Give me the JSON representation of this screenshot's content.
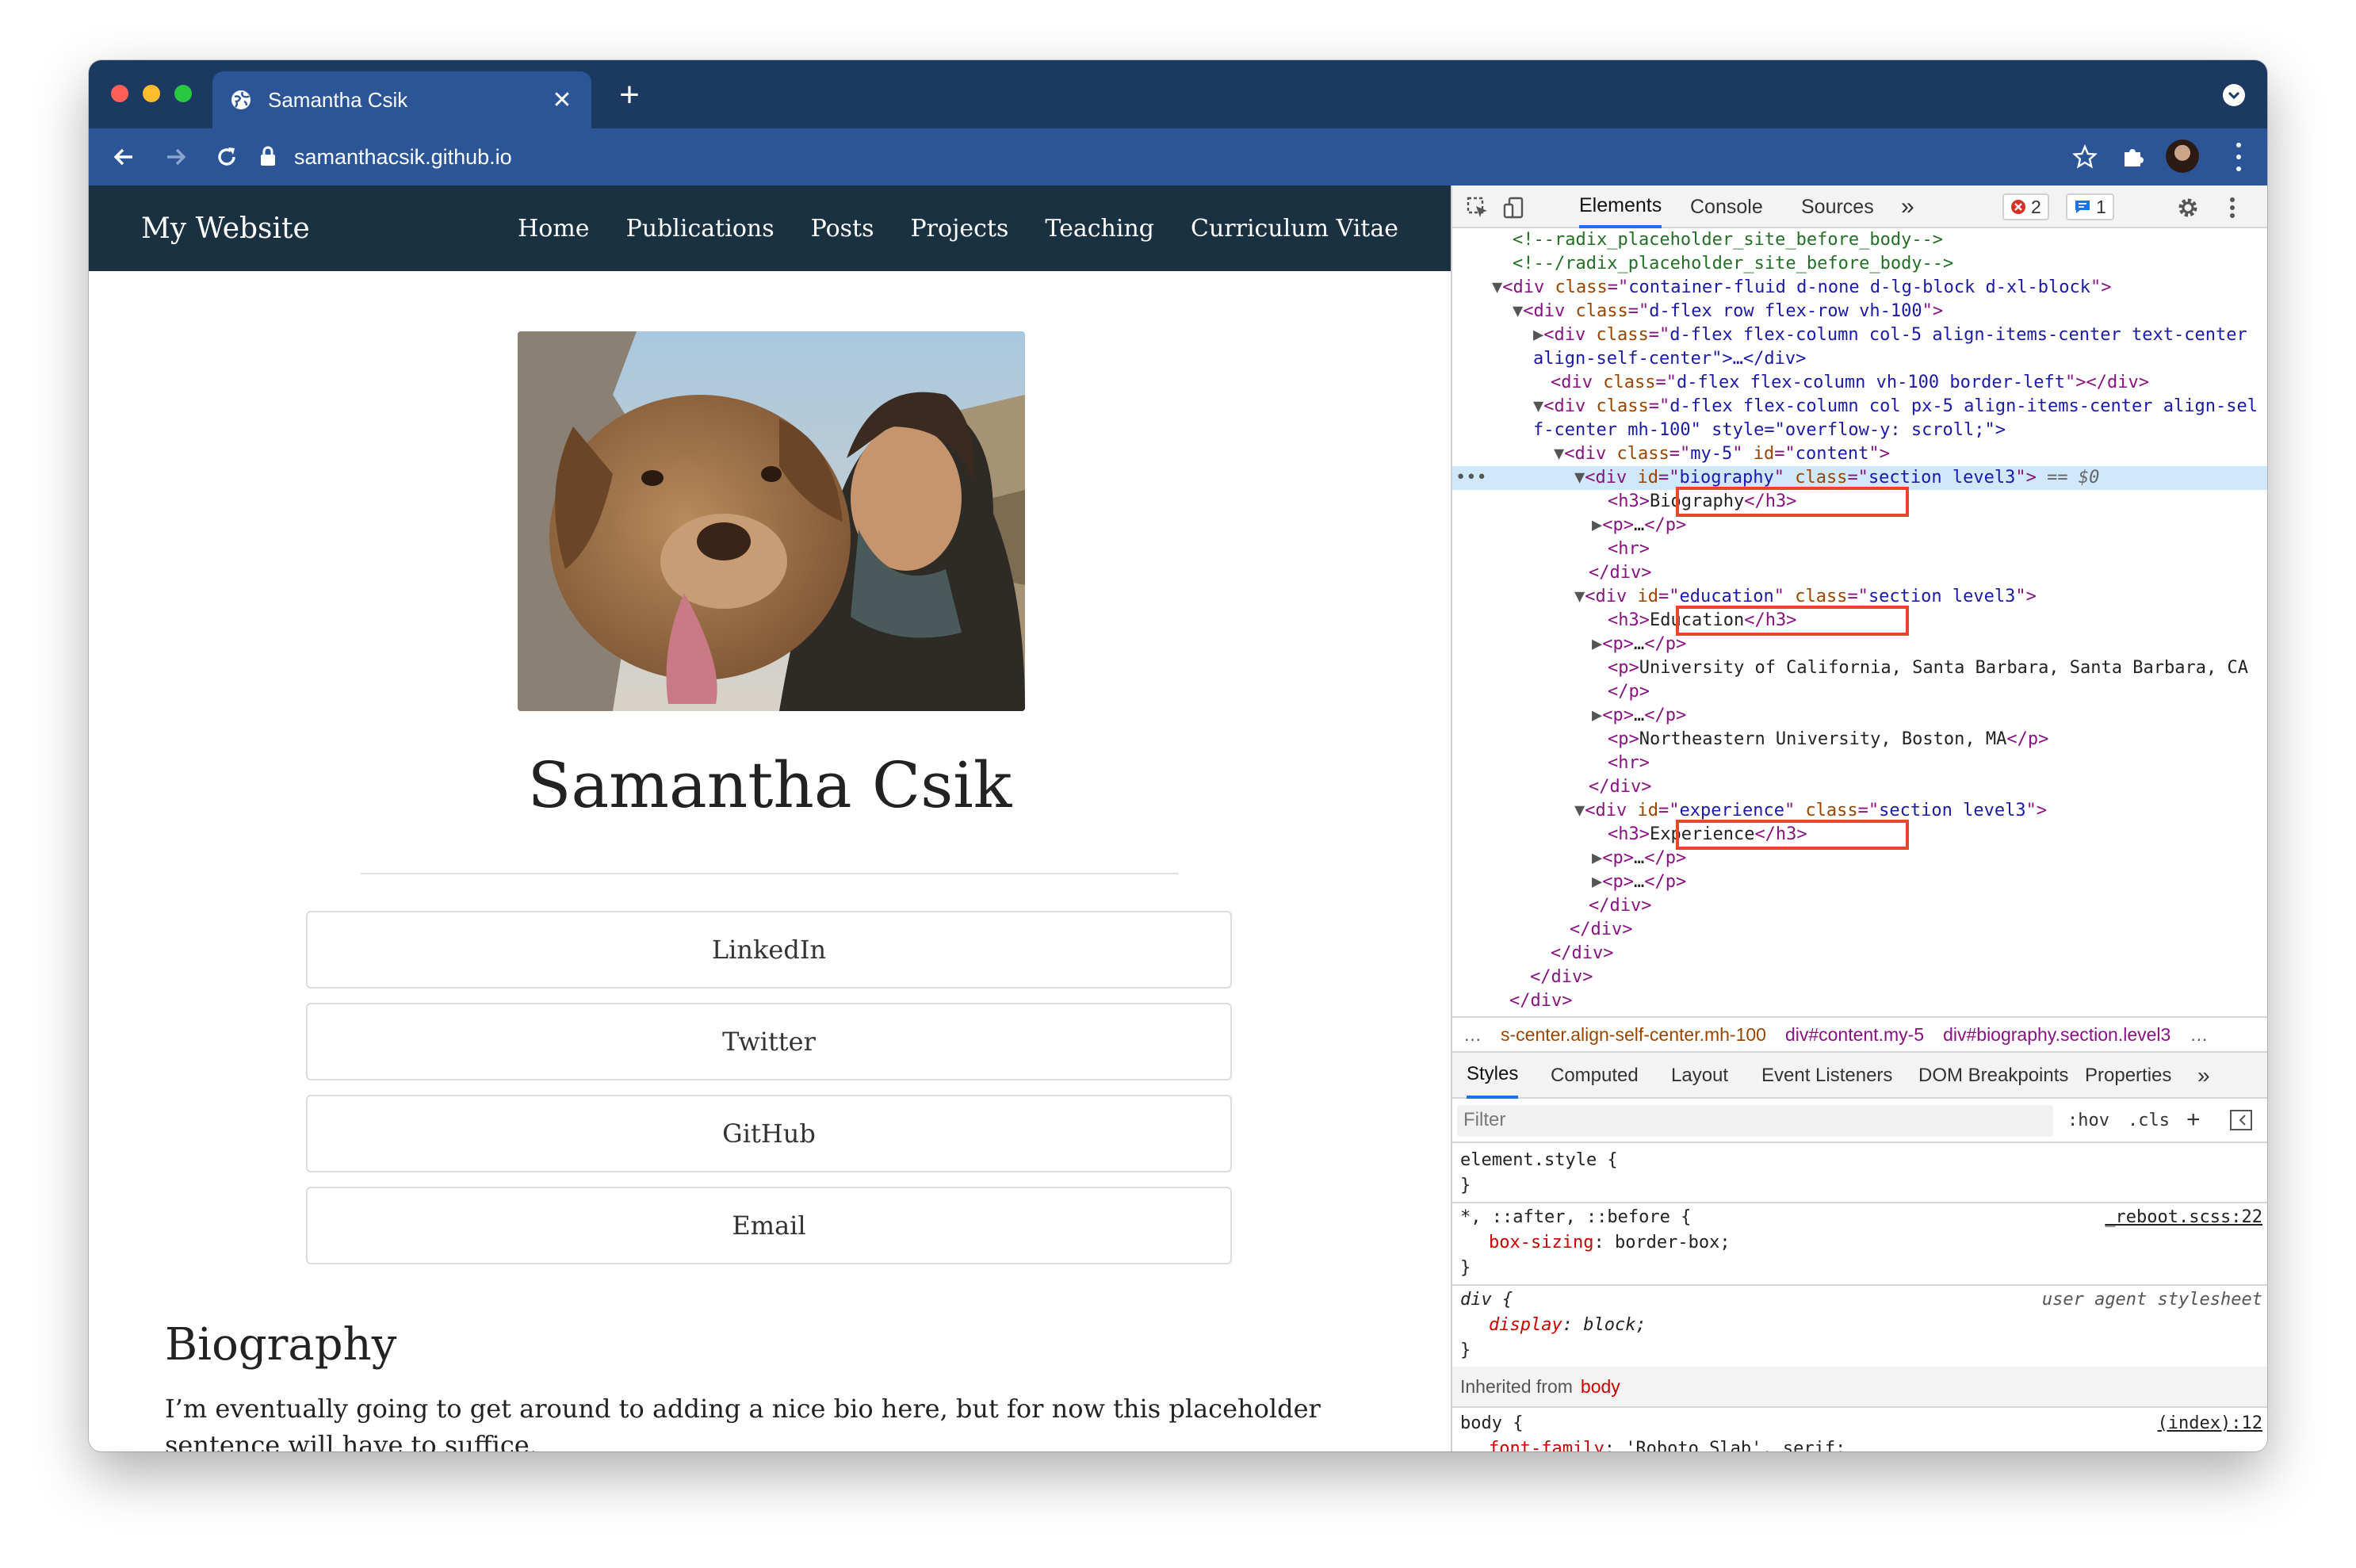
{
  "browser": {
    "tab_title": "Samantha Csik",
    "new_tab": "+",
    "url": "samanthacsik.github.io"
  },
  "site": {
    "brand": "My Website",
    "menu": [
      "Home",
      "Publications",
      "Posts",
      "Projects",
      "Teaching",
      "Curriculum Vitae"
    ],
    "name": "Samantha Csik",
    "social_buttons": [
      "LinkedIn",
      "Twitter",
      "GitHub",
      "Email"
    ],
    "bio_heading": "Biography",
    "bio_text": "I’m eventually going to get around to adding a nice bio here, but for now this placeholder sentence will have to suffice."
  },
  "devtools": {
    "tabs": [
      "Elements",
      "Console",
      "Sources",
      "»"
    ],
    "error_count": "2",
    "message_count": "1",
    "dom": {
      "c1": "<!--radix_placeholder_site_before_body-->",
      "c2": "<!--/radix_placeholder_site_before_body-->",
      "r3_class": "container-fluid d-none d-lg-block d-xl-block",
      "r4_class": "d-flex row flex-row vh-100",
      "r5_class": "d-flex flex-column col-5 align-items-center text-center",
      "r5b": "align-self-center\">…</div>",
      "r6_class": "d-flex flex-column vh-100 border-left",
      "r7_class": "d-flex flex-column col px-5 align-items-center align-sel",
      "r7b": "f-center mh-100\" style=\"overflow-y: scroll;\">",
      "r8_class": "my-5",
      "r8_id": "content",
      "bio_id": "biography",
      "section_class": "section level3",
      "selected_marker": " == $0",
      "h3_bio": "Biography",
      "p_collapsed": "…",
      "edu_id": "education",
      "h3_edu": "Education",
      "p_ucsb": "University of California, Santa Barbara, Santa Barbara, CA",
      "p_neu": "Northeastern University, Boston, MA",
      "exp_id": "experience",
      "h3_exp": "Experience"
    },
    "breadcrumbs": [
      "…",
      "s-center.align-self-center.mh-100",
      "div#content.my-5",
      "div#biography.section.level3",
      "…"
    ],
    "style_tabs": [
      "Styles",
      "Computed",
      "Layout",
      "Event Listeners",
      "DOM Breakpoints",
      "Properties",
      "»"
    ],
    "filter_placeholder": "Filter",
    "hov": ":hov",
    "cls": ".cls",
    "rules": {
      "element_style": "element.style {",
      "close": "}",
      "universal_selector": "*, ::after, ::before {",
      "universal_source": "_reboot.scss:22",
      "box_sizing_prop": "box-sizing",
      "box_sizing_val": ": border-box;",
      "div_selector": "div {",
      "ua_label": "user agent stylesheet",
      "display_prop": "display",
      "display_val": ": block;",
      "inherited_label": "Inherited from",
      "inherited_el": "body",
      "body_selector": "body {",
      "body_source": "(index):12",
      "font_prop": "font-family",
      "font_val": ": 'Roboto Slab', serif;"
    }
  },
  "colors": {
    "tabbar": "#1c3962",
    "toolbar": "#2b5597",
    "site_nav": "#1a3142",
    "devtools_accent": "#1a73e8",
    "highlight_box": "#e8452c"
  }
}
